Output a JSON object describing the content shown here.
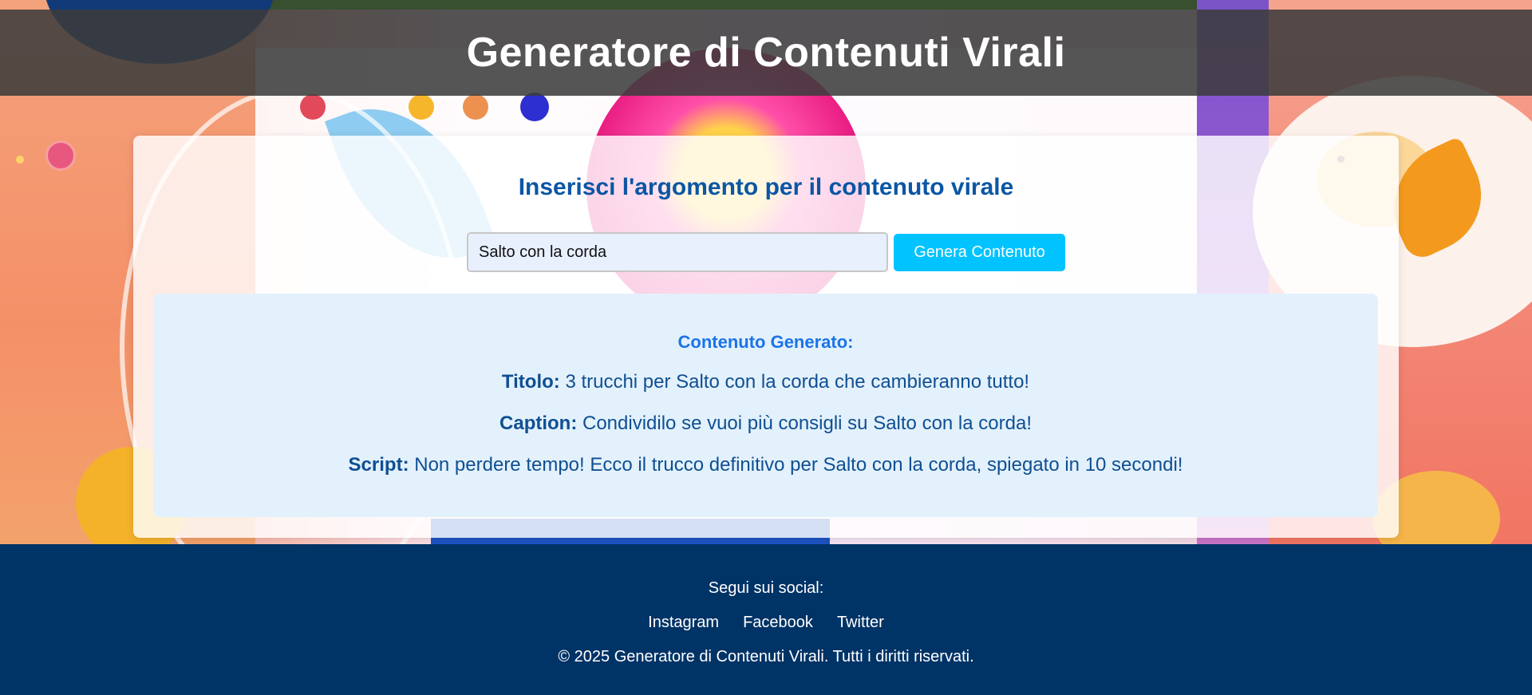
{
  "header": {
    "title": "Generatore di Contenuti Virali"
  },
  "form": {
    "heading": "Inserisci l'argomento per il contenuto virale",
    "topic_value": "Salto con la corda",
    "generate_label": "Genera Contenuto"
  },
  "result": {
    "heading": "Contenuto Generato:",
    "title_label": "Titolo:",
    "title_text": "3 trucchi per Salto con la corda che cambieranno tutto!",
    "caption_label": "Caption:",
    "caption_text": "Condividilo se vuoi più consigli su Salto con la corda!",
    "script_label": "Script:",
    "script_text": "Non perdere tempo! Ecco il trucco definitivo per Salto con la corda, spiegato in 10 secondi!"
  },
  "footer": {
    "follow": "Segui sui social:",
    "links": [
      "Instagram",
      "Facebook",
      "Twitter"
    ],
    "copyright": "© 2025 Generatore di Contenuti Virali. Tutti i diritti riservati."
  },
  "colors": {
    "header_bg": "#3c3c3c",
    "heading": "#0b56a4",
    "button": "#00c3ff",
    "result_bg": "#e3f1fc",
    "footer_bg": "#003366"
  }
}
